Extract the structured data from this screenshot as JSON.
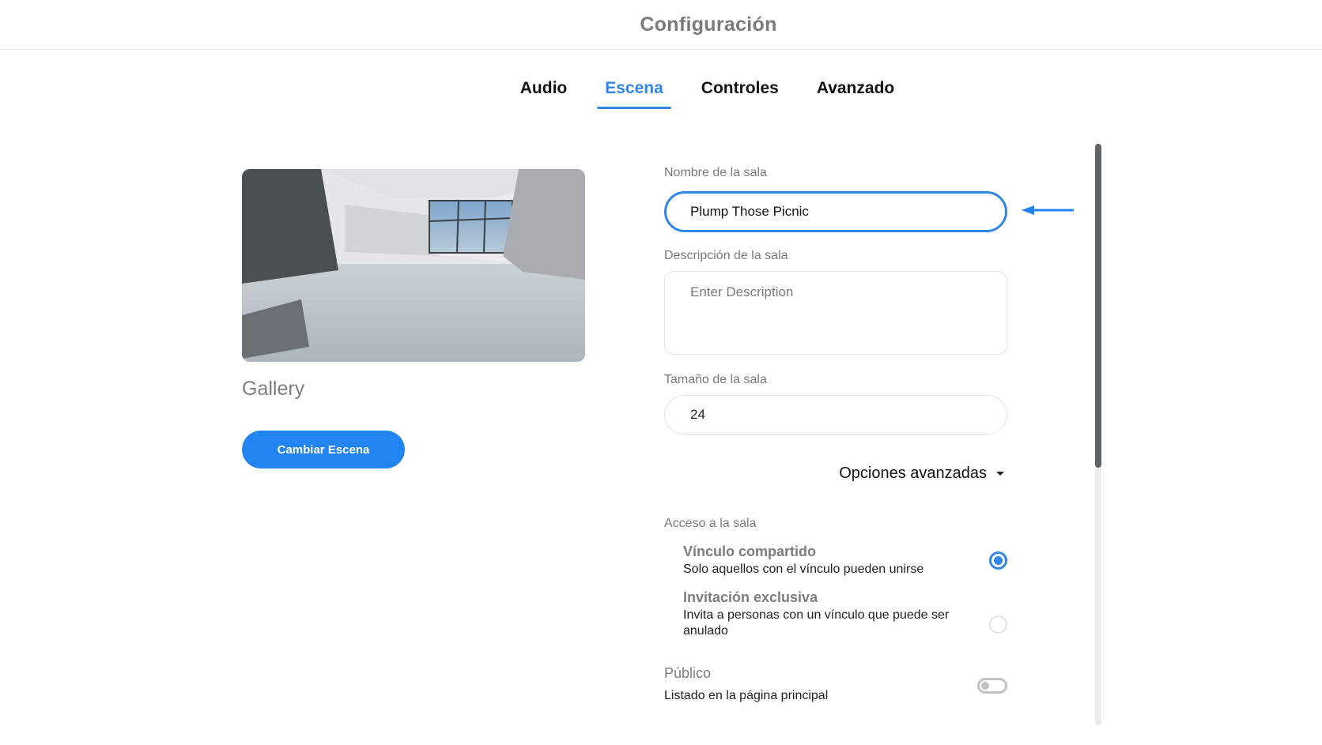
{
  "header": {
    "title": "Configuración"
  },
  "tabs": [
    {
      "label": "Audio",
      "active": false
    },
    {
      "label": "Escena",
      "active": true
    },
    {
      "label": "Controles",
      "active": false
    },
    {
      "label": "Avanzado",
      "active": false
    }
  ],
  "scene": {
    "name": "Gallery",
    "change_button_label": "Cambiar Escena",
    "preview_alt": "Gallery scene preview"
  },
  "form": {
    "room_name": {
      "label": "Nombre de la sala",
      "value": "Plump Those Picnic"
    },
    "room_description": {
      "label": "Descripción de la sala",
      "placeholder": "Enter Description",
      "value": ""
    },
    "room_size": {
      "label": "Tamaño de la sala",
      "value": "24"
    },
    "advanced_options_label": "Opciones avanzadas",
    "access": {
      "label": "Acceso a la sala",
      "options": [
        {
          "title": "Vínculo compartido",
          "description": "Solo aquellos con el vínculo pueden unirse",
          "selected": true
        },
        {
          "title": "Invitación exclusiva",
          "description": "Invita a personas con un vínculo que puede ser anulado",
          "selected": false
        }
      ]
    },
    "public": {
      "title": "Público",
      "description": "Listado en la página principal",
      "enabled": false
    }
  },
  "colors": {
    "accent": "#2f86e6",
    "button": "#2284f0",
    "muted_text": "#7a7a7a"
  }
}
